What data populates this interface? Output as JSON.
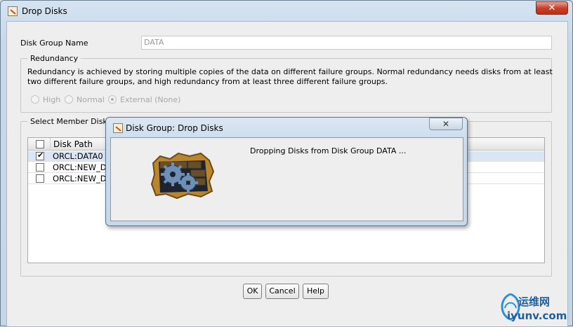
{
  "window": {
    "title": "Drop Disks",
    "close_glyph": "✕"
  },
  "form": {
    "disk_group_name_label": "Disk Group Name",
    "disk_group_name_value": "DATA"
  },
  "redundancy": {
    "legend": "Redundancy",
    "description_line1": "Redundancy is achieved by storing multiple copies of the data on different failure groups. Normal redundancy needs disks from at least",
    "description_line2": "two different failure groups, and high redundancy from at least three different failure groups.",
    "options": [
      {
        "label": "High",
        "selected": false
      },
      {
        "label": "Normal",
        "selected": false
      },
      {
        "label": "External (None)",
        "selected": true
      }
    ]
  },
  "member_disks": {
    "legend": "Select Member Disks",
    "column_header": "Disk Path",
    "rows": [
      {
        "path": "ORCL:DATA0",
        "checked": true
      },
      {
        "path": "ORCL:NEW_D",
        "checked": false
      },
      {
        "path": "ORCL:NEW_D",
        "checked": false
      }
    ]
  },
  "buttons": {
    "ok": "OK",
    "cancel": "Cancel",
    "help": "Help"
  },
  "dialog": {
    "title": "Disk Group: Drop Disks",
    "close_glyph": "✕",
    "message": "Dropping Disks from Disk Group DATA ...",
    "icon": "gears-in-brick-wall-icon"
  },
  "watermark": {
    "cn": "运维网",
    "url": "iyunv.com"
  },
  "colors": {
    "title_bar": "#c6d8ea",
    "panel": "#eeeeee",
    "close_red": "#c9412a",
    "watermark": "#1f5f9e"
  }
}
